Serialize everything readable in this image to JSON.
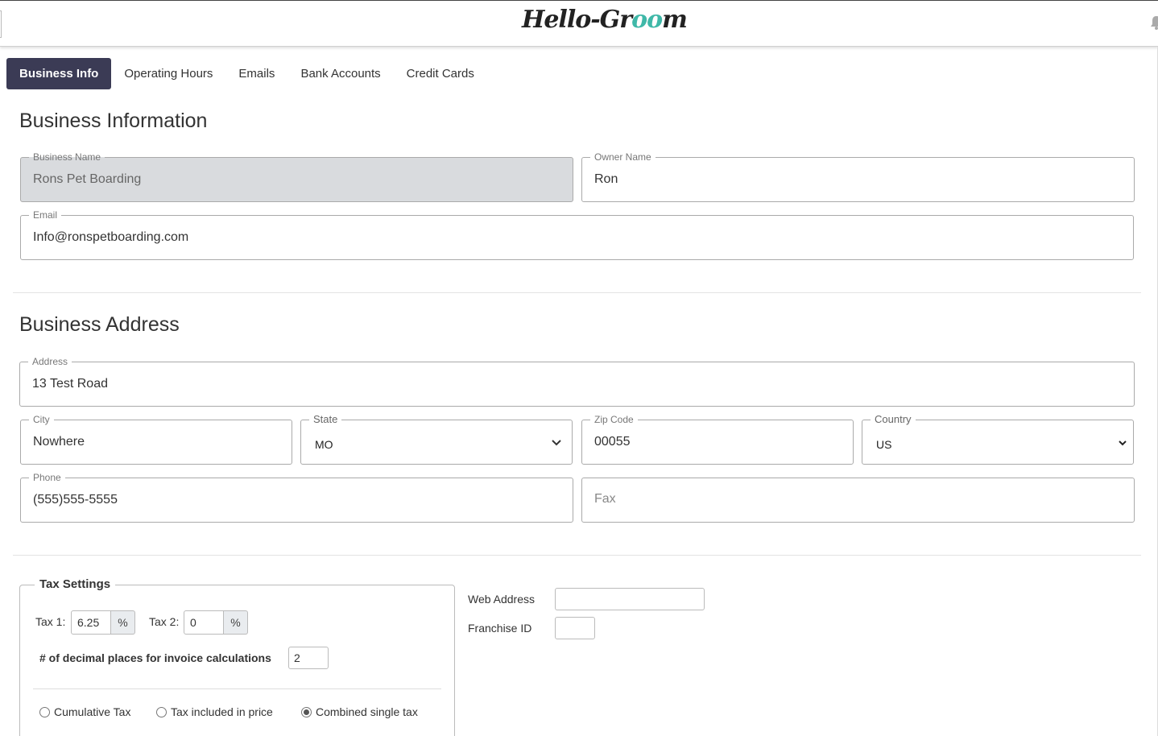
{
  "brand": {
    "logo_text_pre": "Hello-Gr",
    "logo_text_paw": "oo",
    "logo_text_post": "m"
  },
  "tabs": [
    {
      "label": "Business Info",
      "active": true
    },
    {
      "label": "Operating Hours"
    },
    {
      "label": "Emails"
    },
    {
      "label": "Bank Accounts"
    },
    {
      "label": "Credit Cards"
    }
  ],
  "business_info": {
    "heading": "Business Information",
    "business_name": {
      "label": "Business Name",
      "value": "Rons Pet Boarding"
    },
    "owner_name": {
      "label": "Owner Name",
      "value": "Ron"
    },
    "email": {
      "label": "Email",
      "value": "Info@ronspetboarding.com"
    }
  },
  "address": {
    "heading": "Business Address",
    "address": {
      "label": "Address",
      "value": "13 Test Road"
    },
    "city": {
      "label": "City",
      "value": "Nowhere"
    },
    "state": {
      "label": "State",
      "value": "MO"
    },
    "zip": {
      "label": "Zip Code",
      "value": "00055"
    },
    "country": {
      "label": "Country",
      "value": "US"
    },
    "phone": {
      "label": "Phone",
      "value": "(555)555-5555"
    },
    "fax": {
      "placeholder": "Fax"
    }
  },
  "tax": {
    "legend": "Tax Settings",
    "tax1_label": "Tax 1:",
    "tax1_value": "6.25",
    "tax2_label": "Tax 2:",
    "tax2_value": "0",
    "percent": "%",
    "decimals_label": "# of decimal places for invoice calculations",
    "decimals_value": "2",
    "options": [
      {
        "label": "Cumulative Tax",
        "checked": false
      },
      {
        "label": "Tax included in price",
        "checked": false
      },
      {
        "label": "Combined single tax",
        "checked": true
      }
    ]
  },
  "web": {
    "label": "Web Address",
    "value": ""
  },
  "franchise": {
    "label": "Franchise ID",
    "value": ""
  },
  "colors": {
    "active_tab": "#3b3b55",
    "accent": "#3fb8a8"
  }
}
